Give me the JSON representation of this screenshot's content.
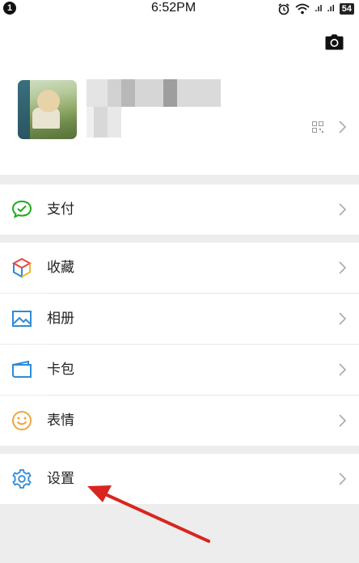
{
  "status_bar": {
    "notification_count": "1",
    "time": "6:52PM",
    "signal_1": ".ıl",
    "signal_2": ".ıl",
    "battery": "54"
  },
  "profile": {
    "camera_icon": "camera-icon",
    "qr_icon": "qr-code-icon"
  },
  "menu": {
    "pay": {
      "label": "支付",
      "icon": "wechat-pay-icon",
      "color": "#1aad19"
    },
    "favorites": {
      "label": "收藏",
      "icon": "cube-icon"
    },
    "album": {
      "label": "相册",
      "icon": "image-icon",
      "color": "#2d8bd8"
    },
    "cards": {
      "label": "卡包",
      "icon": "card-icon",
      "color": "#2d8bd8"
    },
    "stickers": {
      "label": "表情",
      "icon": "smiley-icon",
      "color": "#f0a63a"
    },
    "settings": {
      "label": "设置",
      "icon": "gear-icon",
      "color": "#2d8bd8"
    }
  },
  "annotation": {
    "arrow_color": "#d9251f"
  }
}
